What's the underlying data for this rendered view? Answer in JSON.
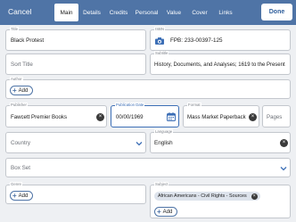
{
  "topbar": {
    "cancel_label": "Cancel",
    "done_label": "Done",
    "tabs": [
      {
        "label": "Main"
      },
      {
        "label": "Details"
      },
      {
        "label": "Credits"
      },
      {
        "label": "Personal"
      },
      {
        "label": "Value"
      },
      {
        "label": "Cover"
      },
      {
        "label": "Links"
      }
    ]
  },
  "form": {
    "title": {
      "label": "Title",
      "value": "Black Protest"
    },
    "isbn": {
      "label": "ISBN",
      "value": "FPB: 233-00397-125",
      "icon": "camera-icon"
    },
    "sort_title": {
      "placeholder": "Sort Title"
    },
    "subtitle": {
      "label": "Subtitle",
      "value": "History, Documents, and Analyses; 1619 to the Present"
    },
    "author": {
      "label": "Author",
      "add_label": "Add"
    },
    "publisher": {
      "label": "Publisher",
      "value": "Fawcett Premier Books"
    },
    "publication_date": {
      "label": "Publication Date",
      "value": "00/00/1969",
      "icon": "calendar-icon"
    },
    "format": {
      "label": "Format",
      "value": "Mass Market Paperback"
    },
    "pages": {
      "placeholder": "Pages"
    },
    "country": {
      "placeholder": "Country"
    },
    "language": {
      "label": "Language",
      "value": "English"
    },
    "box_set": {
      "placeholder": "Box Set"
    },
    "genre": {
      "label": "Genre",
      "add_label": "Add"
    },
    "subject": {
      "label": "Subject",
      "chip": "African Americans - Civil Rights - Sources",
      "add_label": "Add"
    }
  },
  "colors": {
    "header": "#4f74a6",
    "focus": "#3d6fb6",
    "background": "#eef0f3"
  }
}
